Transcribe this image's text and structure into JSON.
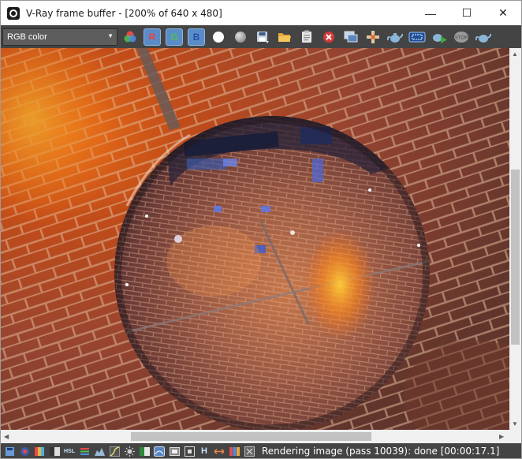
{
  "window": {
    "title": "V-Ray frame buffer - [200% of 640 x 480]",
    "minimize_glyph": "—",
    "maximize_glyph": "☐",
    "close_glyph": "✕"
  },
  "toolbar": {
    "channel_value": "RGB color",
    "red_label": "R",
    "green_label": "G",
    "blue_label": "B",
    "icons": [
      "color-wheel-icon",
      "red-channel-button",
      "green-channel-button",
      "blue-channel-button",
      "white-dot-icon",
      "mono-dot-icon",
      "save-icon",
      "open-folder-icon",
      "clipboard-icon",
      "clear-icon",
      "duplicate-icon",
      "tracking-icon",
      "teapot-icon",
      "region-render-icon",
      "interactive-render-icon",
      "stop-icon",
      "render-icon"
    ]
  },
  "status": {
    "text": "Rendering image (pass 10039): done [00:00:17.1]",
    "h_label": "H",
    "hsl_label": "HSL",
    "icons": [
      "save-history-icon",
      "lens-effects-icon",
      "color-corrections-icon",
      "gamma-icon",
      "hsl-icon",
      "lut-icon",
      "levels-icon",
      "curve-icon",
      "exposure-icon",
      "balance-icon",
      "background-icon",
      "ocio-icon",
      "pixel-info-icon",
      "h-icon",
      "stereo-icon",
      "rgb-icon",
      "settings-icon"
    ]
  },
  "colors": {
    "titlebar": "#ffffff",
    "toolbar": "#444444",
    "channel_button": "#5a8dc8",
    "red_text": "#e84040",
    "green_text": "#4fc04f",
    "blue_text": "#6ea8ff"
  }
}
